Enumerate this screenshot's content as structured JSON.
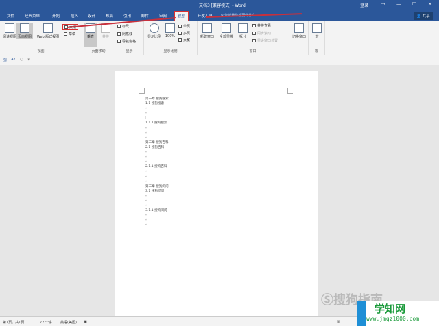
{
  "title": "文档3 [兼容模式] - Word",
  "login": "登录",
  "window_controls": {
    "ribbon_options": "▭",
    "minimize": "—",
    "maximize": "☐",
    "close": "✕"
  },
  "tabs": [
    "文件",
    "经典菜单",
    "开始",
    "插入",
    "设计",
    "布局",
    "引用",
    "邮件",
    "审阅",
    "视图",
    "开发工具"
  ],
  "active_tab": "视图",
  "search_placeholder": "告诉我你想要做什么",
  "share": "共享",
  "ribbon": {
    "views": {
      "label": "视图",
      "read": "阅读视图",
      "print": "页面视图",
      "web": "Web 版式视图",
      "outline": "大纲",
      "draft": "草稿"
    },
    "page_move": {
      "label": "页面移动",
      "vertical": "垂直",
      "side": "并排"
    },
    "show": {
      "label": "显示",
      "ruler": "标尺",
      "gridlines": "网格线",
      "nav": "导航窗格"
    },
    "zoom": {
      "label": "显示比例",
      "zoom": "显示比例",
      "pct": "100%",
      "one": "单页",
      "multi": "多页",
      "width": "页宽"
    },
    "window": {
      "label": "窗口",
      "new": "新建窗口",
      "arrange": "全部重排",
      "split": "拆分",
      "side_by_side": "并排查看",
      "sync": "同步滚动",
      "reset": "重设窗口位置",
      "switch": "切换窗口"
    },
    "macros": {
      "label": "宏",
      "macro": "宏"
    }
  },
  "doc_lines": [
    "第一章  搜狗搜索",
    "1.1 搜狗搜索",
    "↵",
    "↵",
    "|",
    "1.1.1 搜狗搜索",
    "↵",
    "↵",
    "↵",
    "第二章  搜狗百科",
    "2.1 搜狗百科",
    "↵",
    "↵",
    "↵",
    "2.1.1 搜狗百科",
    "↵",
    "↵",
    "↵",
    "第三章  搜狗问问",
    "3.1 搜狗问问",
    "↵",
    "↵",
    "↵",
    "3.1.1 搜狗问问",
    "↵",
    "↵",
    "↵"
  ],
  "status": {
    "page": "第1页，共1页",
    "words": "72 个字",
    "lang": "英语(美国)"
  },
  "watermarks": {
    "sogou": "搜狗指南",
    "site_name": "学知网",
    "site_url": "www.jmqz1000.com"
  }
}
